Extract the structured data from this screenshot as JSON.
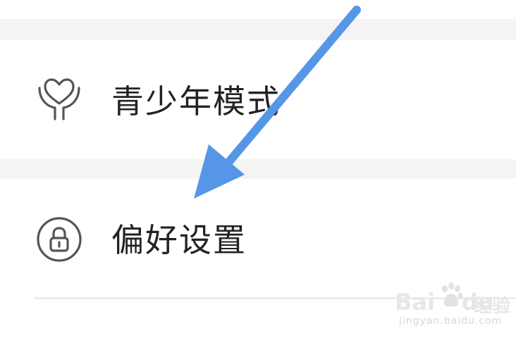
{
  "settings": {
    "items": [
      {
        "label": "青少年模式",
        "icon": "heart-hands-icon"
      },
      {
        "label": "偏好设置",
        "icon": "lock-icon"
      }
    ]
  },
  "annotation": {
    "arrow_color": "#5596e6"
  },
  "watermark": {
    "brand": "Bai",
    "brand_tail": "du",
    "product": "经验",
    "url": "jingyan.baidu.com"
  }
}
